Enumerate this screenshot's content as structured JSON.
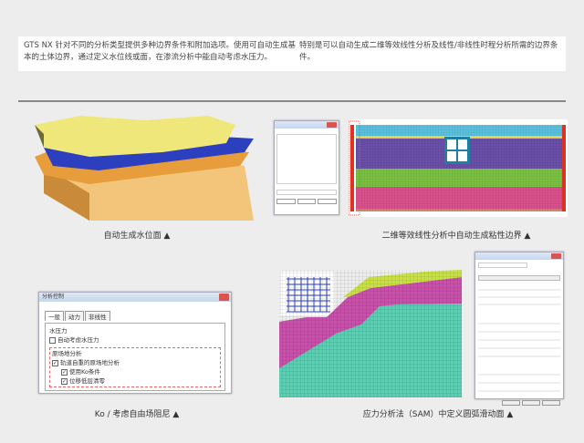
{
  "intro": {
    "left": "GTS NX 针对不同的分析类型提供多种边界条件和附加选项。使用可自动生成基本的土体边界，通过定义水位线或面，在渗流分析中能自动考虑水压力。",
    "right": "特别是可以自动生成二维等效线性分析及线性/非线性时程分析所需的边界条件。"
  },
  "captions": {
    "water": "自动生成水位面 ▲",
    "viscous": "二维等效线性分析中自动生成粘性边界 ▲",
    "ko": "Ko / 考虑自由场阻尼 ▲",
    "sam": "应力分析法（SAM）中定义圆弧滑动面 ▲"
  },
  "analysis_dialog": {
    "title": "分析控制",
    "tabs": [
      "一般",
      "动力",
      "非线性"
    ],
    "group1": "水压力",
    "auto_water": "自动考虑水压力",
    "group2": "原场地分析",
    "opt1": "轨道自重的原场地分析",
    "opt2": "使用Ko条件",
    "opt3": "位移低层清零"
  },
  "colors": {
    "cyan": "#5bc0de",
    "purple": "#6a4fa8",
    "green": "#7ac142",
    "pink": "#d9508a",
    "slope_green": "#5ccdb0",
    "slope_pink": "#c552a8",
    "slope_yellow": "#c8df4a"
  }
}
